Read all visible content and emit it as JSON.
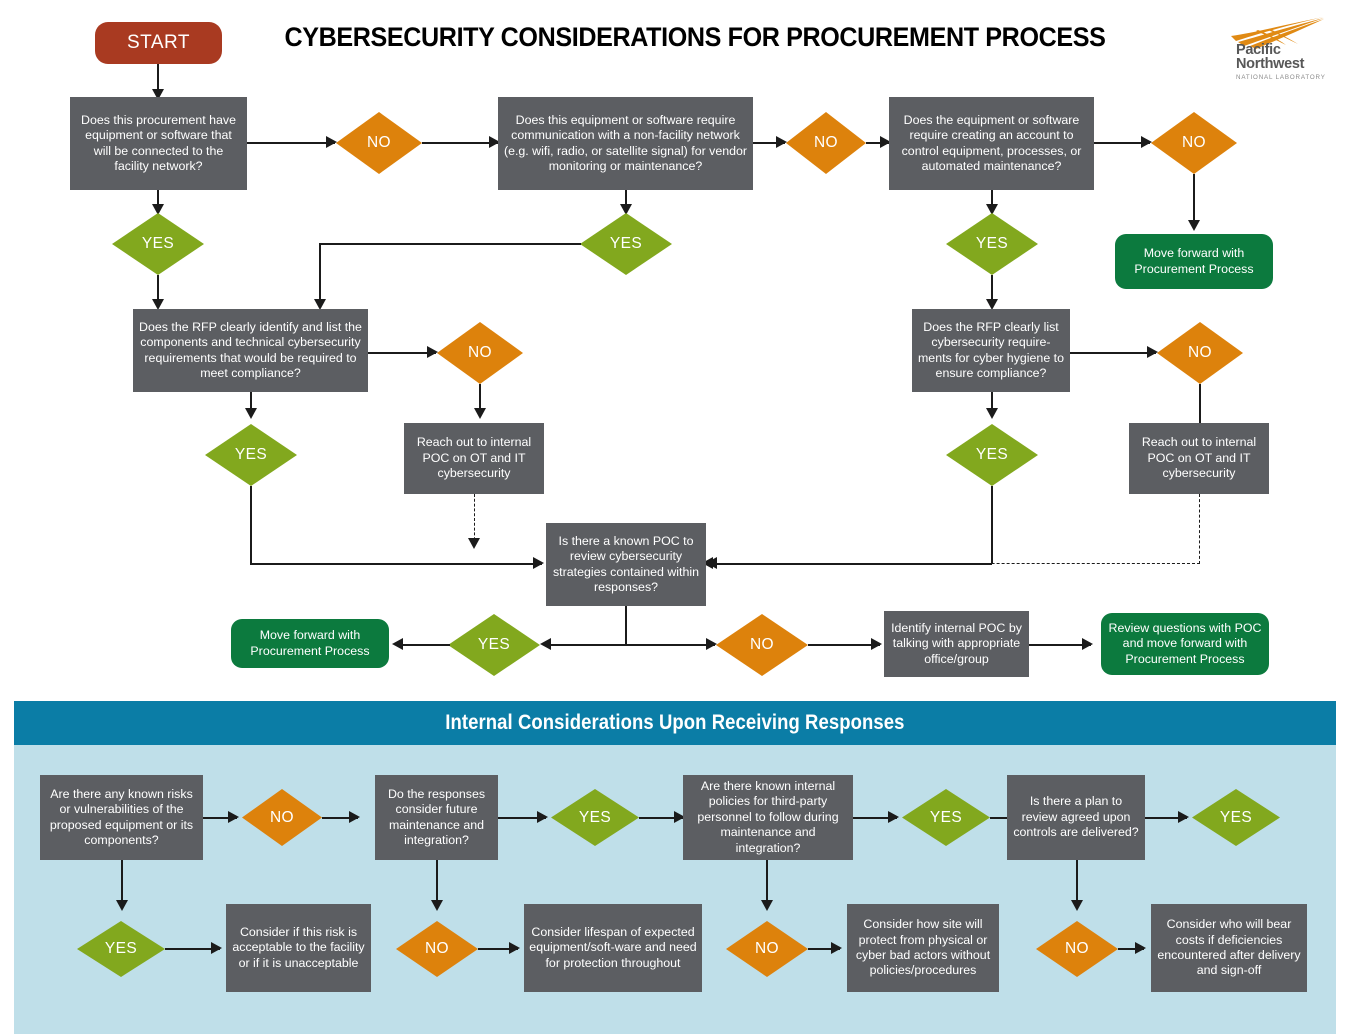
{
  "header": {
    "title": "CYBERSECURITY CONSIDERATIONS FOR PROCUREMENT PROCESS",
    "logo": {
      "name_line1": "Pacific",
      "name_line2": "Northwest",
      "subtitle": "NATIONAL LABORATORY"
    }
  },
  "colors": {
    "process_box": "#5c5e62",
    "yes_diamond": "#82a81e",
    "no_diamond": "#dd820c",
    "start_terminal": "#a93a21",
    "green_terminal": "#0c7a3e",
    "panel_header": "#0b7da6",
    "panel_body": "#bfdfe9",
    "connector": "#1b1b1b"
  },
  "top_flow": {
    "start": "START",
    "q1": "Does this procurement have equipment or software that will be connected to the facility network?",
    "q1_no": "NO",
    "q1_yes": "YES",
    "q2": "Does this equipment or software require communication with a non-facility network (e.g. wifi, radio, or satellite signal) for vendor monitoring or maintenance?",
    "q2_no": "NO",
    "q2_yes": "YES",
    "q3": "Does the equipment or software require creating an account to control equipment,  processes, or automated maintenance?",
    "q3_no": "NO",
    "q3_yes": "YES",
    "q3_no_outcome": "Move forward with Procurement Process",
    "q4": "Does the RFP clearly identify and list the components and technical cybersecurity requirements that would be required to meet compliance?",
    "q4_no": "NO",
    "q4_yes": "YES",
    "q4_no_action": "Reach out to internal POC on OT and IT cybersecurity",
    "q5": "Does the RFP clearly list cybersecurity require-ments for cyber hygiene to ensure compliance?",
    "q5_no": "NO",
    "q5_yes": "YES",
    "q5_no_action": "Reach out to internal POC on OT and IT cybersecurity",
    "q6": "Is there a known POC to review cybersecurity strategies contained within responses?",
    "q6_yes": "YES",
    "q6_no": "NO",
    "q6_yes_outcome": "Move forward with Procurement Process",
    "q6_no_action": "Identify internal POC by talking with appropriate office/group",
    "q6_no_outcome": "Review questions with POC and move forward with Procurement Process"
  },
  "panel": {
    "title": "Internal Considerations Upon Receiving Responses",
    "b1": "Are there any known risks or vulnerabilities of the proposed equipment or its components?",
    "b1_no": "NO",
    "b1_yes": "YES",
    "b1_yes_action": "Consider if this risk is acceptable to the facility or if it is unacceptable",
    "b2": "Do the responses consider future maintenance and integration?",
    "b2_yes": "YES",
    "b2_no": "NO",
    "b2_no_action": "Consider lifespan of expected equipment/soft-ware and need for protection throughout",
    "b3": "Are there known internal policies for third-party personnel to follow during maintenance and integration?",
    "b3_yes": "YES",
    "b3_no": "NO",
    "b3_no_action": "Consider how site will protect from physical or cyber bad actors without policies/procedures",
    "b4": "Is there a plan to review agreed upon controls are delivered?",
    "b4_yes": "YES",
    "b4_no": "NO",
    "b4_no_action": "Consider who will bear costs if deficiencies encountered after delivery and sign-off"
  }
}
